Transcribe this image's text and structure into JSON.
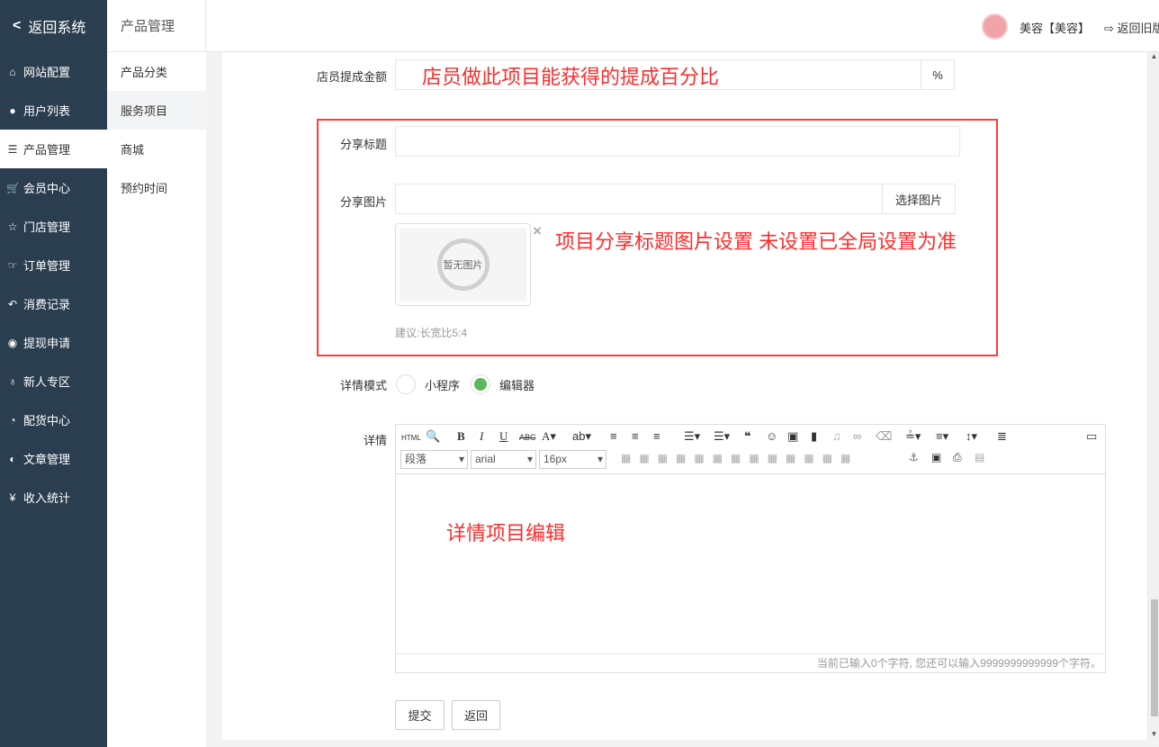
{
  "sidebar": {
    "back": "返回系统",
    "items": [
      {
        "icon": "home-icon",
        "glyph": "⌂",
        "label": "网站配置"
      },
      {
        "icon": "user-icon",
        "glyph": "●",
        "label": "用户列表"
      },
      {
        "icon": "server-icon",
        "glyph": "☰",
        "label": "产品管理",
        "active": true
      },
      {
        "icon": "cart-icon",
        "glyph": "🛒",
        "label": "会员中心"
      },
      {
        "icon": "star-icon",
        "glyph": "☆",
        "label": "门店管理"
      },
      {
        "icon": "thumb-icon",
        "glyph": "☞",
        "label": "订单管理"
      },
      {
        "icon": "reply-icon",
        "glyph": "↶",
        "label": "消费记录"
      },
      {
        "icon": "wechat-icon",
        "glyph": "◉",
        "label": "提现申请"
      },
      {
        "icon": "map-marker-icon",
        "glyph": "♁",
        "label": "新人专区"
      },
      {
        "icon": "pie-chart-icon",
        "glyph": "◔",
        "label": "配货中心"
      },
      {
        "icon": "adjust-icon",
        "glyph": "◐",
        "label": "文章管理"
      },
      {
        "icon": "yen-icon",
        "glyph": "¥",
        "label": "收入统计"
      }
    ]
  },
  "subnav": {
    "title": "产品管理",
    "items": [
      "产品分类",
      "服务项目",
      "商城",
      "预约时间"
    ]
  },
  "header": {
    "user": "美容【美容】",
    "old_version": "返回旧版"
  },
  "form": {
    "commission_label": "店员提成金额",
    "commission_note": "店员做此项目能获得的提成百分比",
    "commission_unit": "%",
    "share_title_label": "分享标题",
    "share_title_value": "",
    "share_image_label": "分享图片",
    "choose_image": "选择图片",
    "no_image": "暂无图片",
    "remove": "×",
    "share_note": "项目分享标题图片设置 未设置已全局设置为准",
    "hint": "建议:长宽比5:4",
    "detail_mode_label": "详情模式",
    "mode_options": [
      "小程序",
      "编辑器"
    ],
    "mode_selected": "编辑器",
    "detail_label": "详情",
    "editor_note": "详情项目编辑",
    "editor": {
      "html": "HTML",
      "paragraph": "段落",
      "font": "arial",
      "size": "16px",
      "count": "当前已输入0个字符, 您还可以输入9999999999999个字符。"
    },
    "submit": "提交",
    "back": "返回"
  },
  "colors": {
    "sidebar": "#2b3e50",
    "accent_red": "#ff2c2c",
    "radio_green": "#5cb85c"
  }
}
